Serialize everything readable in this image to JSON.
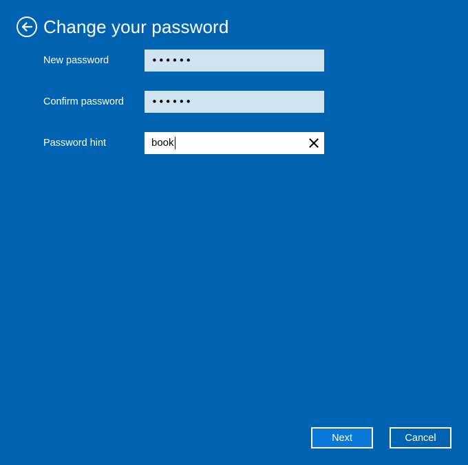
{
  "header": {
    "back_icon": "back-arrow-circle-icon",
    "title": "Change your password"
  },
  "form": {
    "new_password": {
      "label": "New password",
      "value": "••••••"
    },
    "confirm_password": {
      "label": "Confirm password",
      "value": "••••••"
    },
    "password_hint": {
      "label": "Password hint",
      "value": "book",
      "clear_icon": "close-icon"
    }
  },
  "buttons": {
    "next_label": "Next",
    "cancel_label": "Cancel"
  },
  "colors": {
    "background": "#0063b1",
    "input_inactive": "#cfe3f1",
    "input_active": "#ffffff",
    "next_button": "#0a78d7",
    "text": "#ffffff"
  }
}
